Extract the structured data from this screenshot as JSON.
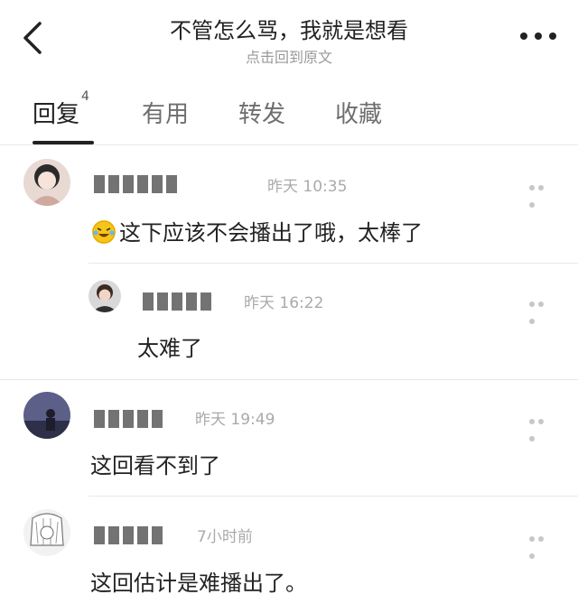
{
  "header": {
    "title": "不管怎么骂，我就是想看",
    "subtitle": "点击回到原文"
  },
  "tabs": [
    {
      "label": "回复",
      "count": "4",
      "active": true
    },
    {
      "label": "有用"
    },
    {
      "label": "转发"
    },
    {
      "label": "收藏"
    }
  ],
  "comments": [
    {
      "time": "昨天 10:35",
      "text": "这下应该不会播出了哦，太棒了",
      "emoji": "laughing-crying-emoji"
    },
    {
      "time": "昨天 16:22",
      "text": "太难了",
      "nested": true
    },
    {
      "time": "昨天 19:49",
      "text": "这回看不到了"
    },
    {
      "time": "7小时前",
      "text": "这回估计是难播出了。"
    }
  ],
  "colors": {
    "accent": "#222222",
    "muted": "#9a9a9a",
    "divider": "#e9e9e9",
    "emoji": "#f5c518"
  }
}
